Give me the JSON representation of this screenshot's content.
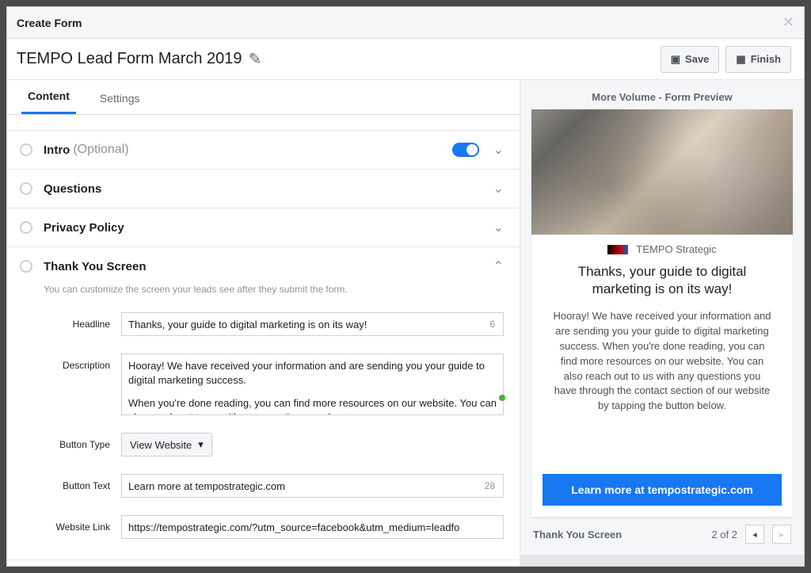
{
  "modal": {
    "title": "Create Form"
  },
  "header": {
    "form_name": "TEMPO Lead Form March 2019",
    "save": "Save",
    "finish": "Finish"
  },
  "tabs": {
    "content": "Content",
    "settings": "Settings"
  },
  "sections": {
    "intro": {
      "title": "Intro",
      "optional": "(Optional)"
    },
    "questions": {
      "title": "Questions"
    },
    "privacy": {
      "title": "Privacy Policy"
    },
    "thankyou": {
      "title": "Thank You Screen",
      "help": "You can customize the screen your leads see after they submit the form.",
      "labels": {
        "headline": "Headline",
        "description": "Description",
        "button_type": "Button Type",
        "button_text": "Button Text",
        "website_link": "Website Link"
      },
      "headline_value": "Thanks, your guide to digital marketing is on its way!",
      "headline_count": "6",
      "description_p1": "Hooray! We have received your information and are sending you your guide to digital marketing success.",
      "description_p2": "When you're done reading, you can find more resources on our website. You can also reach out to us with any questions you have",
      "button_type_value": "View Website",
      "button_text_value": "Learn more at tempostrategic.com",
      "button_text_count": "28",
      "website_link_value": "https://tempostrategic.com/?utm_source=facebook&utm_medium=leadfo"
    }
  },
  "preview": {
    "title": "More Volume - Form Preview",
    "brand": "TEMPO Strategic",
    "headline": "Thanks, your guide to digital marketing is on its way!",
    "desc": "Hooray! We have received your information and are sending you your guide to digital marketing success. When you're done reading, you can find more resources on our website. You can also reach out to us with any questions you have through the contact section of our website by tapping the button below.",
    "cta": "Learn more at tempostrategic.com",
    "pager_label": "Thank You Screen",
    "pager_count": "2 of 2"
  }
}
